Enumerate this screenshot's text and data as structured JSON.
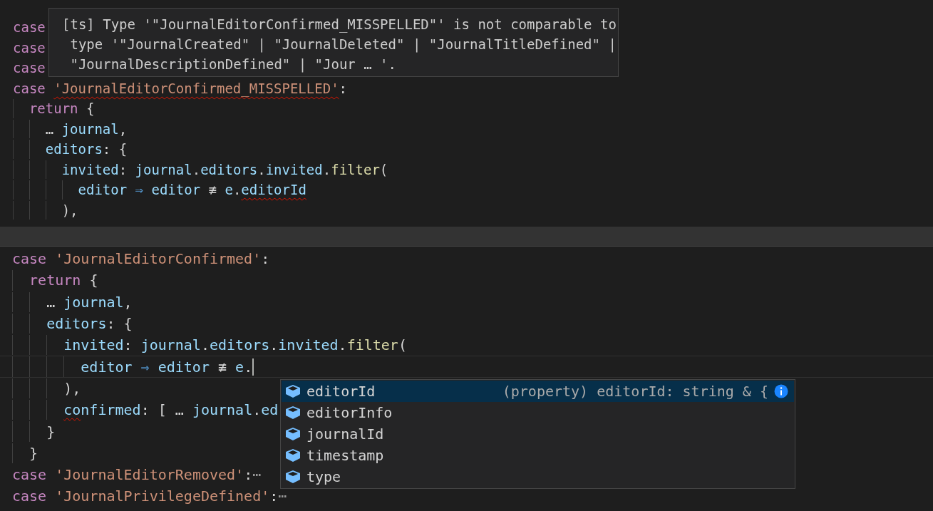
{
  "top_pane": {
    "lines": [
      {
        "tokens": [
          {
            "text": "case",
            "kind": "keyword"
          }
        ]
      },
      {
        "tokens": [
          {
            "text": "case",
            "kind": "keyword"
          }
        ]
      },
      {
        "tokens": [
          {
            "text": "case",
            "kind": "keyword"
          }
        ]
      },
      {
        "tokens": [
          {
            "text": "case ",
            "kind": "keyword"
          },
          {
            "text": "'JournalEditorConfirmed_MISSPELLED'",
            "kind": "string",
            "error": true
          },
          {
            "text": ":",
            "kind": "punct"
          }
        ],
        "children": [
          {
            "tokens": [
              {
                "text": "return ",
                "kind": "keyword"
              },
              {
                "text": "{",
                "kind": "punct"
              }
            ],
            "children": [
              {
                "tokens": [
                  {
                    "text": "… ",
                    "kind": "punct"
                  },
                  {
                    "text": "journal",
                    "kind": "ident"
                  },
                  {
                    "text": ",",
                    "kind": "punct"
                  }
                ]
              },
              {
                "tokens": [
                  {
                    "text": "editors",
                    "kind": "ident"
                  },
                  {
                    "text": ": {",
                    "kind": "punct"
                  }
                ],
                "children": [
                  {
                    "tokens": [
                      {
                        "text": "invited",
                        "kind": "ident"
                      },
                      {
                        "text": ": ",
                        "kind": "punct"
                      },
                      {
                        "text": "journal",
                        "kind": "ident"
                      },
                      {
                        "text": ".",
                        "kind": "punct"
                      },
                      {
                        "text": "editors",
                        "kind": "ident"
                      },
                      {
                        "text": ".",
                        "kind": "punct"
                      },
                      {
                        "text": "invited",
                        "kind": "ident"
                      },
                      {
                        "text": ".",
                        "kind": "punct"
                      },
                      {
                        "text": "filter",
                        "kind": "func"
                      },
                      {
                        "text": "(",
                        "kind": "punct"
                      }
                    ],
                    "children": [
                      {
                        "tokens": [
                          {
                            "text": "editor ",
                            "kind": "ident"
                          },
                          {
                            "text": "⇒ ",
                            "kind": "op"
                          },
                          {
                            "text": "editor ",
                            "kind": "ident"
                          },
                          {
                            "text": "≢ ",
                            "kind": "punct"
                          },
                          {
                            "text": "e",
                            "kind": "ident"
                          },
                          {
                            "text": ".",
                            "kind": "punct"
                          },
                          {
                            "text": "editorId",
                            "kind": "ident",
                            "error": true
                          }
                        ]
                      }
                    ]
                  },
                  {
                    "tokens": [
                      {
                        "text": "),",
                        "kind": "punct"
                      }
                    ]
                  }
                ]
              }
            ]
          }
        ]
      }
    ]
  },
  "tooltip": {
    "text": "[ts] Type '\"JournalEditorConfirmed_MISSPELLED\"' is not comparable to\n type '\"JournalCreated\" | \"JournalDeleted\" | \"JournalTitleDefined\" |\n \"JournalDescriptionDefined\" | \"Jour … '."
  },
  "bottom_pane": {
    "lines": [
      {
        "tokens": [
          {
            "text": "case ",
            "kind": "keyword"
          },
          {
            "text": "'JournalEditorConfirmed'",
            "kind": "string"
          },
          {
            "text": ":",
            "kind": "punct"
          }
        ],
        "children": [
          {
            "tokens": [
              {
                "text": "return ",
                "kind": "keyword"
              },
              {
                "text": "{",
                "kind": "punct"
              }
            ],
            "children": [
              {
                "tokens": [
                  {
                    "text": "… ",
                    "kind": "punct"
                  },
                  {
                    "text": "journal",
                    "kind": "ident"
                  },
                  {
                    "text": ",",
                    "kind": "punct"
                  }
                ]
              },
              {
                "tokens": [
                  {
                    "text": "editors",
                    "kind": "ident"
                  },
                  {
                    "text": ": {",
                    "kind": "punct"
                  }
                ],
                "children": [
                  {
                    "tokens": [
                      {
                        "text": "invited",
                        "kind": "ident"
                      },
                      {
                        "text": ": ",
                        "kind": "punct"
                      },
                      {
                        "text": "journal",
                        "kind": "ident"
                      },
                      {
                        "text": ".",
                        "kind": "punct"
                      },
                      {
                        "text": "editors",
                        "kind": "ident"
                      },
                      {
                        "text": ".",
                        "kind": "punct"
                      },
                      {
                        "text": "invited",
                        "kind": "ident"
                      },
                      {
                        "text": ".",
                        "kind": "punct"
                      },
                      {
                        "text": "filter",
                        "kind": "func"
                      },
                      {
                        "text": "(",
                        "kind": "punct"
                      }
                    ],
                    "children": [
                      {
                        "current": true,
                        "cursor": true,
                        "tokens": [
                          {
                            "text": "editor ",
                            "kind": "ident"
                          },
                          {
                            "text": "⇒ ",
                            "kind": "op"
                          },
                          {
                            "text": "editor ",
                            "kind": "ident"
                          },
                          {
                            "text": "≢ ",
                            "kind": "punct"
                          },
                          {
                            "text": "e",
                            "kind": "ident"
                          },
                          {
                            "text": ".",
                            "kind": "punct"
                          }
                        ]
                      }
                    ]
                  },
                  {
                    "tokens": [
                      {
                        "text": "),",
                        "kind": "punct"
                      }
                    ]
                  },
                  {
                    "tokens": [
                      {
                        "text": "co",
                        "kind": "ident",
                        "error": true
                      },
                      {
                        "text": "nfirmed",
                        "kind": "ident"
                      },
                      {
                        "text": ": [ ",
                        "kind": "punct"
                      },
                      {
                        "text": "… ",
                        "kind": "punct"
                      },
                      {
                        "text": "journal",
                        "kind": "ident"
                      },
                      {
                        "text": ".",
                        "kind": "punct"
                      },
                      {
                        "text": "ed",
                        "kind": "ident"
                      }
                    ]
                  }
                ]
              },
              {
                "tokens": [
                  {
                    "text": "}",
                    "kind": "punct"
                  }
                ]
              }
            ]
          },
          {
            "tokens": [
              {
                "text": "}",
                "kind": "punct"
              }
            ]
          }
        ]
      },
      {
        "tokens": [
          {
            "text": "case ",
            "kind": "keyword"
          },
          {
            "text": "'JournalEditorRemoved'",
            "kind": "string"
          },
          {
            "text": ":",
            "kind": "punct"
          },
          {
            "text": "⋯",
            "kind": "fold"
          }
        ]
      },
      {
        "tokens": [
          {
            "text": "case ",
            "kind": "keyword"
          },
          {
            "text": "'JournalPrivilegeDefined'",
            "kind": "string"
          },
          {
            "text": ":",
            "kind": "punct"
          },
          {
            "text": "⋯",
            "kind": "fold"
          }
        ]
      }
    ]
  },
  "suggestions": [
    {
      "label": "editorId",
      "selected": true,
      "detail": "(property) editorId: string & {"
    },
    {
      "label": "editorInfo",
      "selected": false
    },
    {
      "label": "journalId",
      "selected": false
    },
    {
      "label": "timestamp",
      "selected": false
    },
    {
      "label": "type",
      "selected": false
    }
  ]
}
